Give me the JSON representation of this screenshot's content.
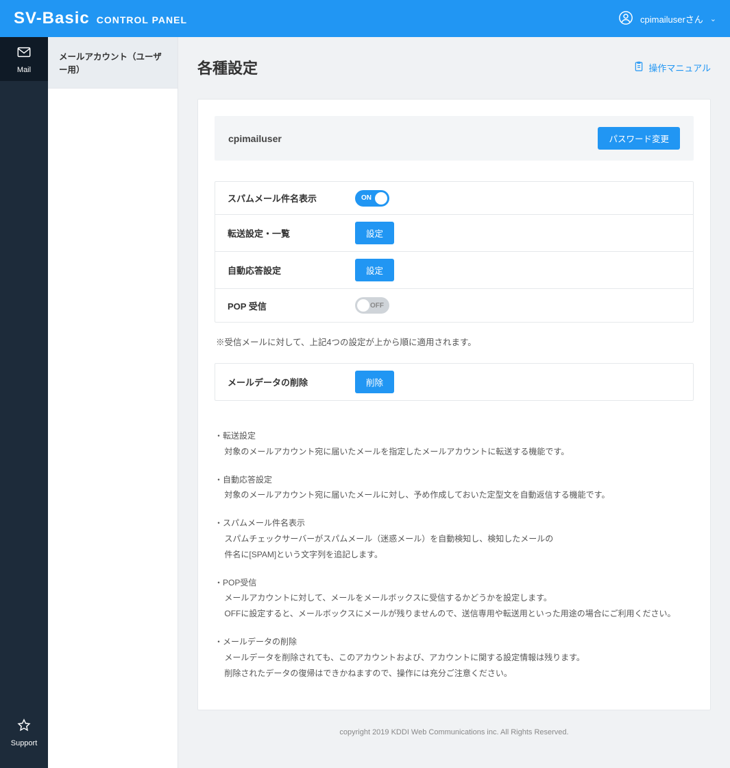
{
  "header": {
    "brand_main": "SV-Basic",
    "brand_sub": "CONTROL PANEL",
    "user_label": "cpimailuserさん"
  },
  "sidebar": {
    "mail_label": "Mail",
    "support_label": "Support"
  },
  "subnav": {
    "item0": "メールアカウント（ユーザー用）"
  },
  "page": {
    "title": "各種設定",
    "manual_link": "操作マニュアル"
  },
  "user_panel": {
    "username": "cpimailuser",
    "password_button": "パスワード変更"
  },
  "settings": {
    "spam_label": "スパムメール件名表示",
    "spam_toggle_text": "ON",
    "forward_label": "転送設定・一覧",
    "forward_button": "設定",
    "autoreply_label": "自動応答設定",
    "autoreply_button": "設定",
    "pop_label": "POP 受信",
    "pop_toggle_text": "OFF"
  },
  "note": "※受信メールに対して、上記4つの設定が上から順に適用されます。",
  "delete_panel": {
    "label": "メールデータの削除",
    "button": "削除"
  },
  "help": {
    "h1_title": "転送設定",
    "h1_l1": "対象のメールアカウント宛に届いたメールを指定したメールアカウントに転送する機能です。",
    "h2_title": "自動応答設定",
    "h2_l1": "対象のメールアカウント宛に届いたメールに対し、予め作成しておいた定型文を自動返信する機能です。",
    "h3_title": "スパムメール件名表示",
    "h3_l1": "スパムチェックサーバーがスパムメール（迷惑メール）を自動検知し、検知したメールの",
    "h3_l2": "件名に[SPAM]という文字列を追記します。",
    "h4_title": "POP受信",
    "h4_l1": "メールアカウントに対して、メールをメールボックスに受信するかどうかを設定します。",
    "h4_l2": "OFFに設定すると、メールボックスにメールが残りませんので、送信専用や転送用といった用途の場合にご利用ください。",
    "h5_title": "メールデータの削除",
    "h5_l1": "メールデータを削除されても、このアカウントおよび、アカウントに関する設定情報は残ります。",
    "h5_l2": "削除されたデータの復帰はできかねますので、操作には充分ご注意ください。"
  },
  "footer": "copyright 2019 KDDI Web Communications inc. All Rights Reserved."
}
